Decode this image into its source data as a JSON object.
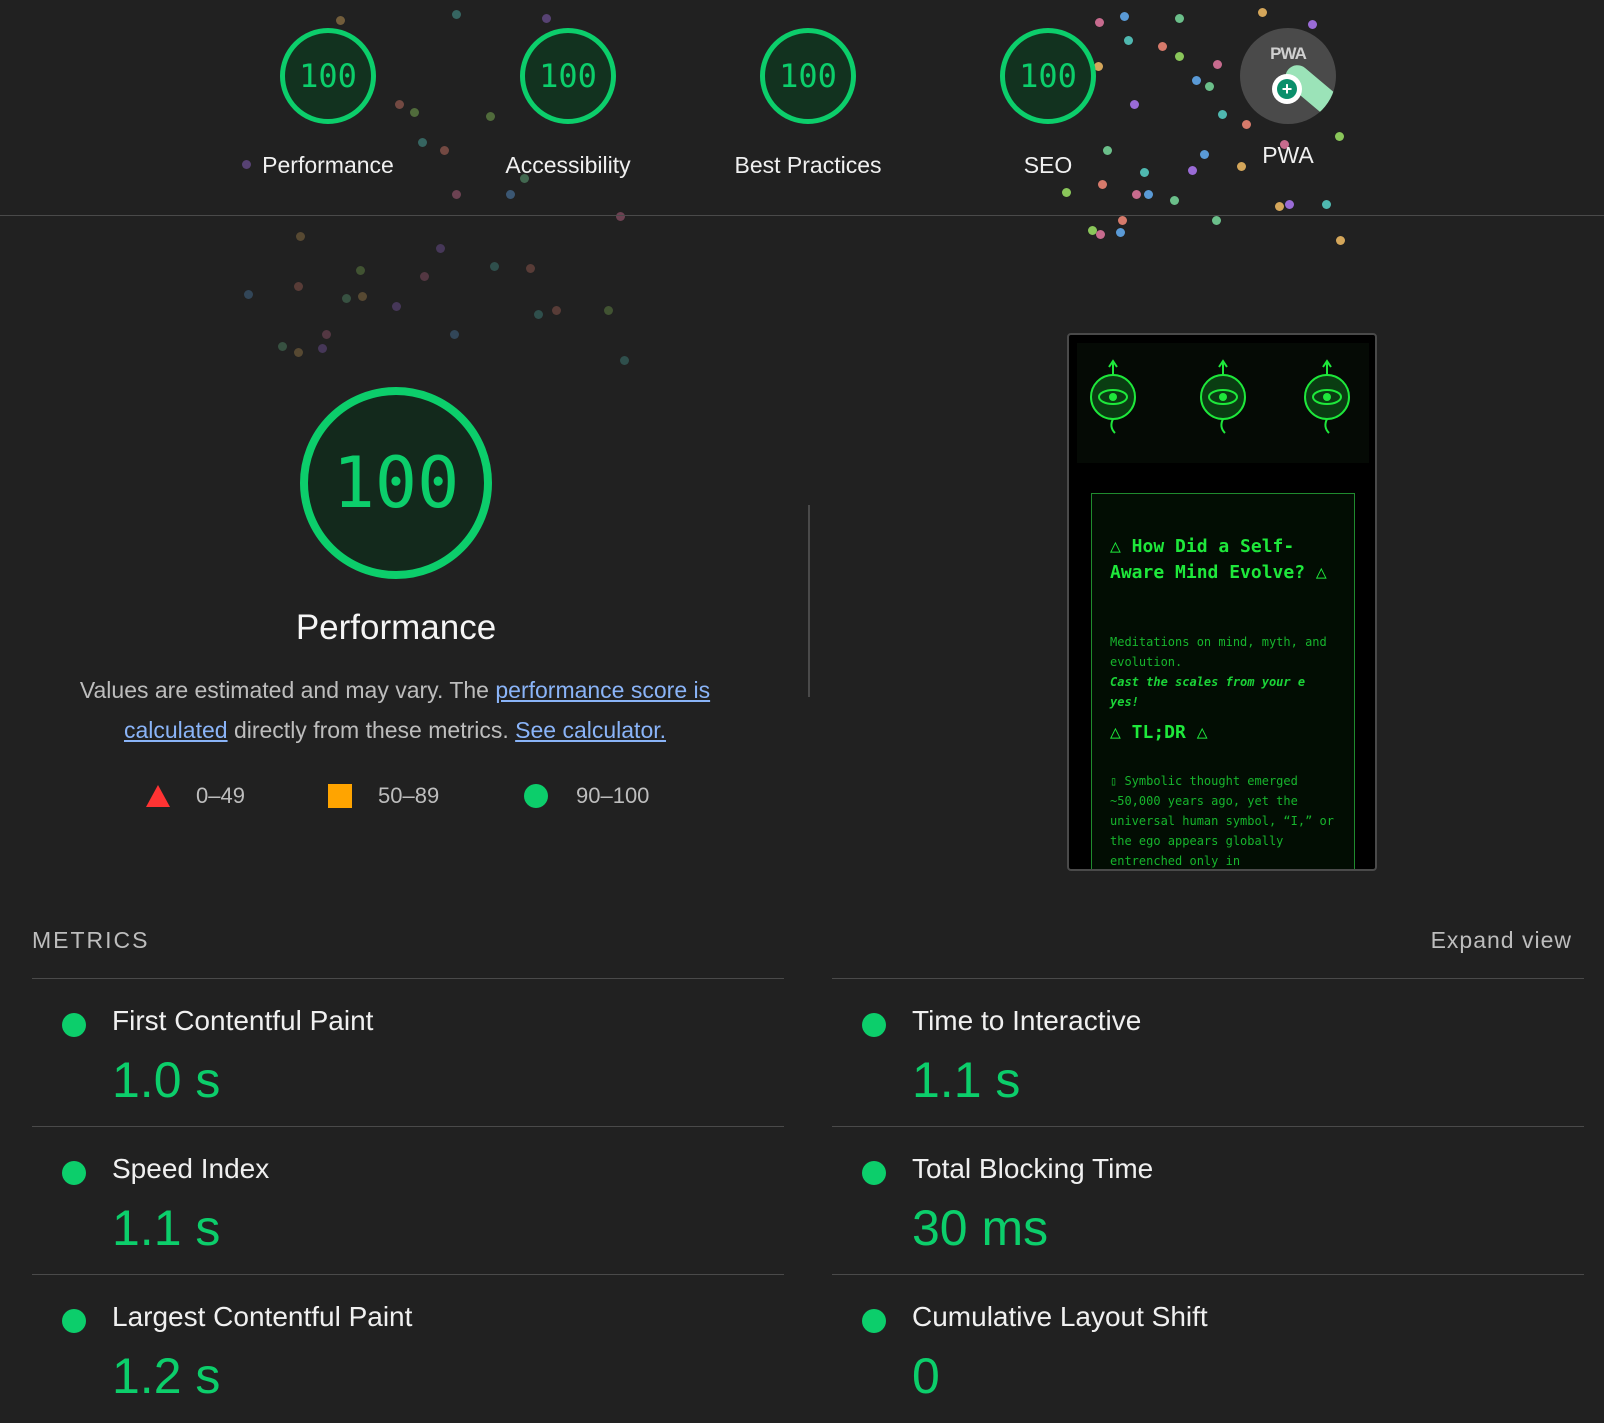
{
  "colors": {
    "pass": "#0cce6b",
    "average": "#ffa400",
    "fail": "#ff3333",
    "background": "#212121"
  },
  "top_gauges": [
    {
      "score": "100",
      "label": "Performance"
    },
    {
      "score": "100",
      "label": "Accessibility"
    },
    {
      "score": "100",
      "label": "Best Practices"
    },
    {
      "score": "100",
      "label": "SEO"
    }
  ],
  "pwa": {
    "badge_text": "PWA",
    "label": "PWA",
    "icon": "pwa-badge-icon"
  },
  "performance": {
    "score": "100",
    "title": "Performance",
    "desc_prefix": "Values are estimated and may vary. The ",
    "link_score": "performance score is calculated",
    "desc_middle": " directly from these metrics. ",
    "link_calculator": "See calculator."
  },
  "legend": {
    "fail": "0–49",
    "average": "50–89",
    "pass": "90–100"
  },
  "screenshot": {
    "title": "△ How Did a Self-Aware Mind Evolve? △",
    "subtitle": "Meditations on mind, myth, and evolution.",
    "tagline": "Cast the scales from your e\nyes!",
    "tldr": "△ TL;DR △",
    "body": "▯ Symbolic thought emerged ~50,000 years ago, yet the universal human symbol, “I,” or the ego appears globally entrenched only in"
  },
  "metrics": {
    "heading": "METRICS",
    "expand_label": "Expand view",
    "items": [
      {
        "label": "First Contentful Paint",
        "value": "1.0 s"
      },
      {
        "label": "Time to Interactive",
        "value": "1.1 s"
      },
      {
        "label": "Speed Index",
        "value": "1.1 s"
      },
      {
        "label": "Total Blocking Time",
        "value": "30 ms"
      },
      {
        "label": "Largest Contentful Paint",
        "value": "1.2 s"
      },
      {
        "label": "Cumulative Layout Shift",
        "value": "0"
      }
    ]
  }
}
